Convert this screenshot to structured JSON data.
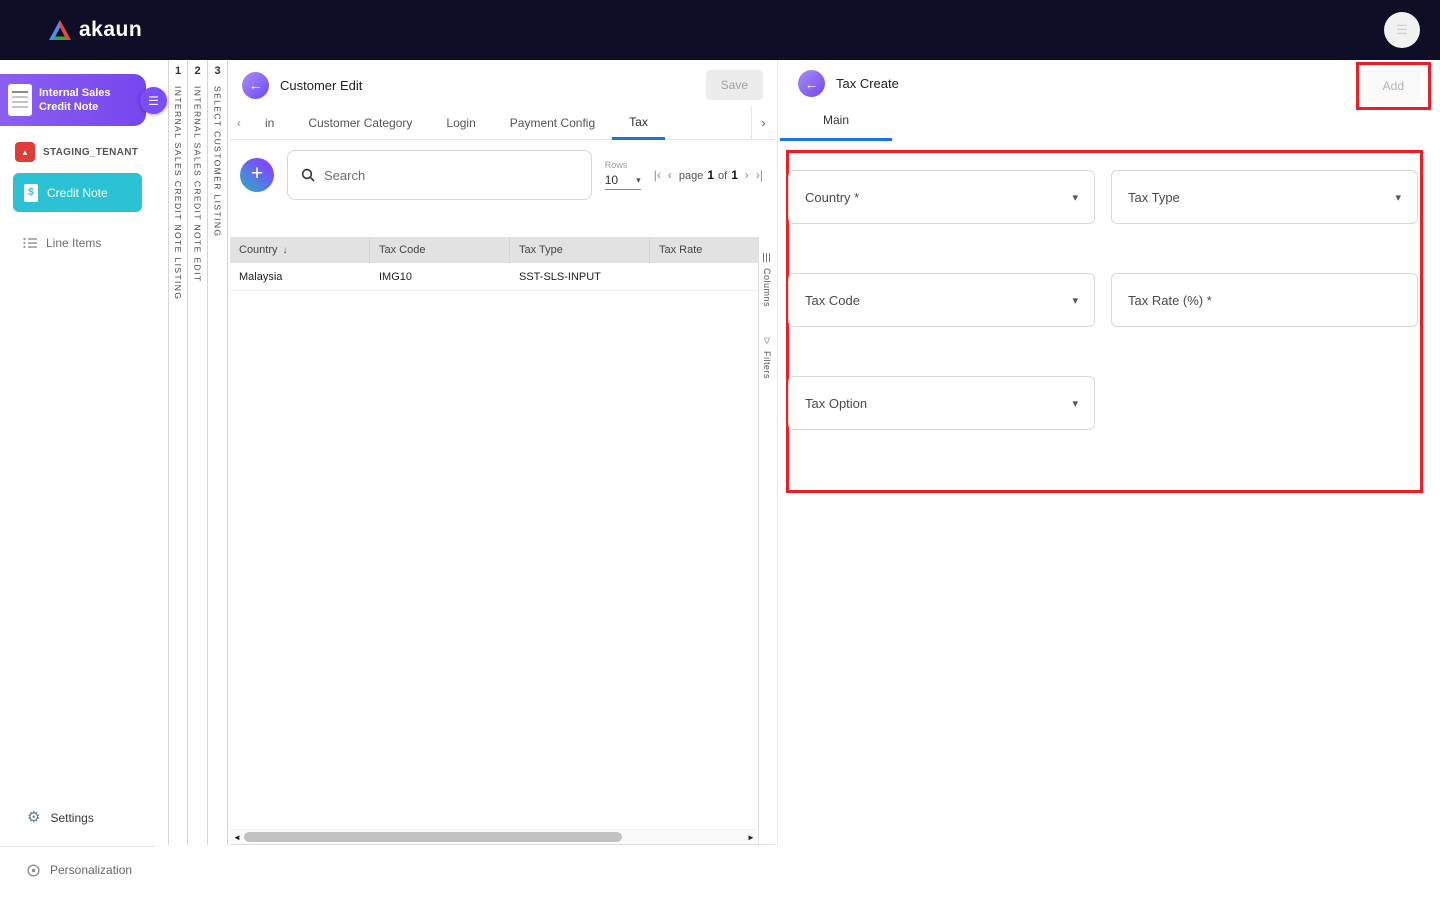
{
  "colors": {
    "topbar_bg": "#0e0e26",
    "accent_purple": "#7c4dff",
    "accent_cyan": "#2bc2d6",
    "tab_active_blue": "#1a73e8",
    "annotation_red": "#ee1c25"
  },
  "icons": {
    "menu": "☰",
    "gear": "⚙",
    "caret_down": "▾",
    "sort_desc": "↓",
    "chevron_left": "‹",
    "chevron_right": "›",
    "page_first": "|‹",
    "page_prev": "‹",
    "page_next": "›",
    "page_last": "›|",
    "filter": "▽",
    "back_arrow": "←",
    "plus": "+",
    "scroll_left": "◄",
    "scroll_right": "►",
    "pdf_glyph": "▲",
    "credit_glyph": "$"
  },
  "topbar": {
    "logo_text": "akaun"
  },
  "sidebar": {
    "app_title": "Internal Sales Credit Note",
    "tenant": "STAGING_TENANT",
    "items": [
      {
        "label": "Credit Note"
      },
      {
        "label": "Line Items"
      }
    ],
    "footer": [
      {
        "label": "Settings"
      },
      {
        "label": "Personalization"
      }
    ]
  },
  "strips": [
    {
      "num": "1",
      "label": "INTERNAL SALES CREDIT NOTE LISTING"
    },
    {
      "num": "2",
      "label": "INTERNAL SALES CREDIT NOTE EDIT"
    },
    {
      "num": "3",
      "label": "SELECT CUSTOMER LISTING"
    }
  ],
  "customer_panel": {
    "title": "Customer Edit",
    "save_label": "Save",
    "tabs": [
      "in",
      "Customer Category",
      "Login",
      "Payment Config",
      "Tax"
    ],
    "active_tab": "Tax",
    "search_placeholder": "Search",
    "rows_label": "Rows",
    "rows_value": "10",
    "pagination": {
      "page_word": "page",
      "current": "1",
      "of_word": "of",
      "total": "1"
    },
    "table": {
      "headers": [
        "Country",
        "Tax Code",
        "Tax Type",
        "Tax Rate"
      ],
      "rows": [
        {
          "country": "Malaysia",
          "tax_code": "IMG10",
          "tax_type": "SST-SLS-INPUT",
          "tax_rate": ""
        }
      ]
    },
    "rail": {
      "columns_label": "Columns",
      "filters_label": "Filters"
    }
  },
  "tax_panel": {
    "title": "Tax Create",
    "add_label": "Add",
    "tab": "Main",
    "fields": [
      {
        "label": "Country *",
        "type": "select"
      },
      {
        "label": "Tax Type",
        "type": "select"
      },
      {
        "label": "Tax Code",
        "type": "select"
      },
      {
        "label": "Tax Rate (%) *",
        "type": "text"
      },
      {
        "label": "Tax Option",
        "type": "select"
      }
    ]
  }
}
